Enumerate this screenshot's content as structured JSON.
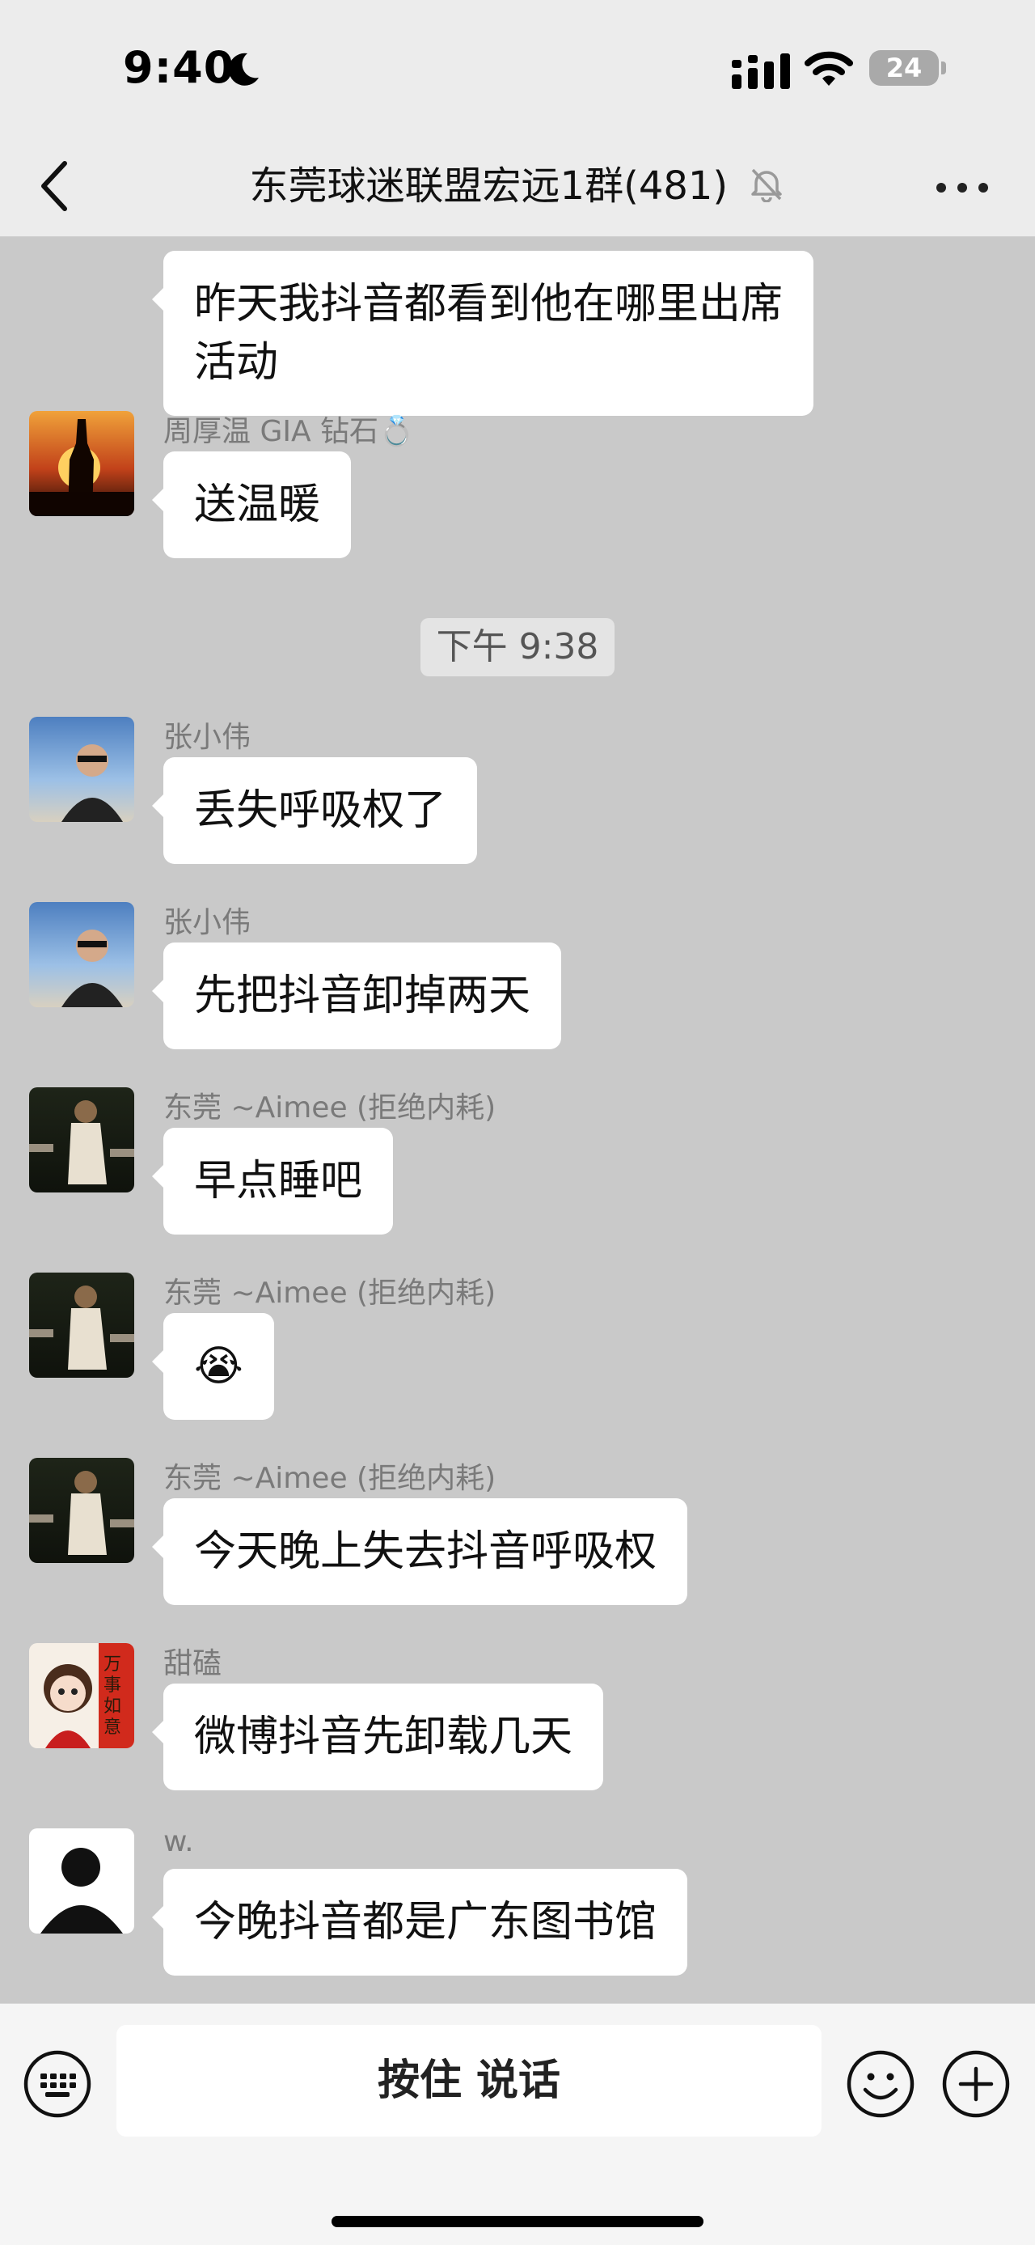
{
  "status_bar": {
    "time": "9:40",
    "battery": "24"
  },
  "nav": {
    "title": "东莞球迷联盟宏远1群(481)"
  },
  "timestamp": "下午 9:38",
  "messages": [
    {
      "sender": "",
      "lines": [
        "昨天我抖音都看到他在哪里出席",
        "活动"
      ]
    },
    {
      "sender": "周厚温  GIA 钻石💍",
      "text": "送温暖"
    },
    {
      "sender": "张小伟",
      "text": "丢失呼吸权了"
    },
    {
      "sender": "张小伟",
      "text": "先把抖音卸掉两天"
    },
    {
      "sender": "东莞 ~Aimee (拒绝内耗)",
      "text": "早点睡吧"
    },
    {
      "sender": "东莞 ~Aimee (拒绝内耗)",
      "text": "😭"
    },
    {
      "sender": "东莞 ~Aimee (拒绝内耗)",
      "text": "今天晚上失去抖音呼吸权"
    },
    {
      "sender": "甜磕",
      "text": "微博抖音先卸载几天",
      "avatar_text": "万事如意"
    },
    {
      "sender": "w.",
      "text": "今晚抖音都是广东图书馆"
    }
  ],
  "input_bar": {
    "hold_to_talk": "按住 说话"
  }
}
